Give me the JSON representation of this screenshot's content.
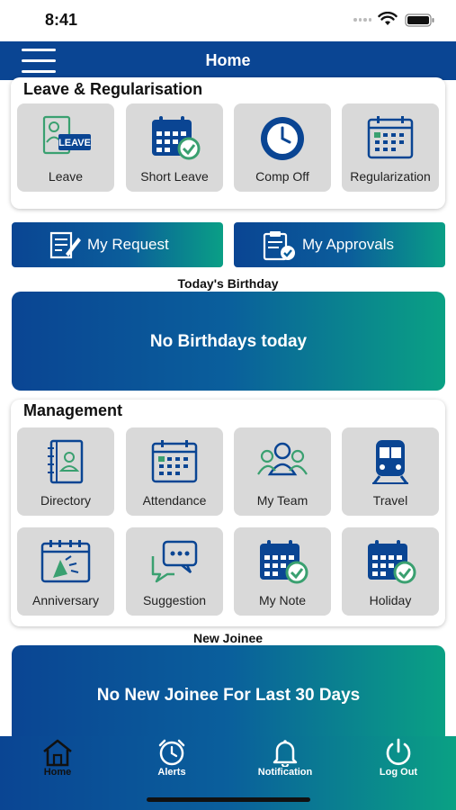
{
  "status": {
    "time": "8:41"
  },
  "nav": {
    "title": "Home"
  },
  "leave_section": {
    "title": "Leave & Regularisation",
    "tiles": [
      {
        "label": "Leave",
        "icon": "leave-badge-icon"
      },
      {
        "label": "Short Leave",
        "icon": "calendar-check-icon"
      },
      {
        "label": "Comp Off",
        "icon": "clock-icon"
      },
      {
        "label": "Regularization",
        "icon": "calendar-grid-icon"
      }
    ],
    "leave_badge_text": "LEAVE"
  },
  "actions": {
    "my_request": "My Request",
    "my_approvals": "My Approvals"
  },
  "birthday": {
    "heading": "Today's Birthday",
    "message": "No Birthdays today"
  },
  "management": {
    "title": "Management",
    "tiles": [
      {
        "label": "Directory",
        "icon": "directory-book-icon"
      },
      {
        "label": "Attendance",
        "icon": "calendar-grid-icon"
      },
      {
        "label": "My Team",
        "icon": "team-icon"
      },
      {
        "label": "Travel",
        "icon": "train-icon"
      },
      {
        "label": "Anniversary",
        "icon": "celebration-calendar-icon"
      },
      {
        "label": "Suggestion",
        "icon": "chat-bubbles-icon"
      },
      {
        "label": "My Note",
        "icon": "calendar-check-icon"
      },
      {
        "label": "Holiday",
        "icon": "calendar-check-icon"
      }
    ]
  },
  "joinee": {
    "heading": "New Joinee",
    "message": "No New Joinee For Last 30 Days"
  },
  "tabs": [
    {
      "label": "Home",
      "icon": "home-icon",
      "active": true
    },
    {
      "label": "Alerts",
      "icon": "alarm-clock-icon",
      "active": false
    },
    {
      "label": "Notification",
      "icon": "bell-icon",
      "active": false
    },
    {
      "label": "Log Out",
      "icon": "power-icon",
      "active": false
    }
  ],
  "colors": {
    "primary": "#0a4593",
    "accent": "#0aa184",
    "tile_bg": "#d9d9d9",
    "icon_green": "#3aa070"
  }
}
